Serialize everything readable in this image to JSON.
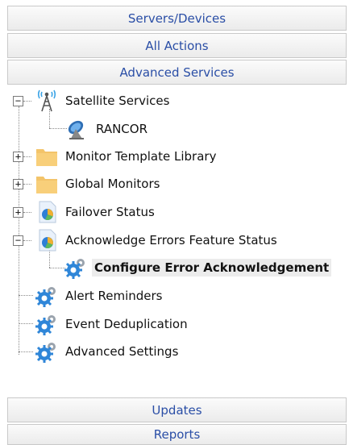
{
  "nav": {
    "servers_devices": "Servers/Devices",
    "all_actions": "All Actions",
    "advanced_services": "Advanced Services",
    "updates": "Updates",
    "reports": "Reports"
  },
  "tree": {
    "satellite_services": "Satellite Services",
    "rancor": "RANCOR",
    "monitor_template_library": "Monitor Template Library",
    "global_monitors": "Global Monitors",
    "failover_status": "Failover Status",
    "acknowledge_errors": "Acknowledge Errors Feature Status",
    "configure_error_ack": "Configure Error Acknowledgement",
    "alert_reminders": "Alert Reminders",
    "event_deduplication": "Event Deduplication",
    "advanced_settings": "Advanced Settings"
  },
  "toggles": {
    "collapse": "−",
    "expand": "+"
  },
  "colors": {
    "nav_text": "#2a4ea6",
    "selected_bg": "#ececec"
  }
}
